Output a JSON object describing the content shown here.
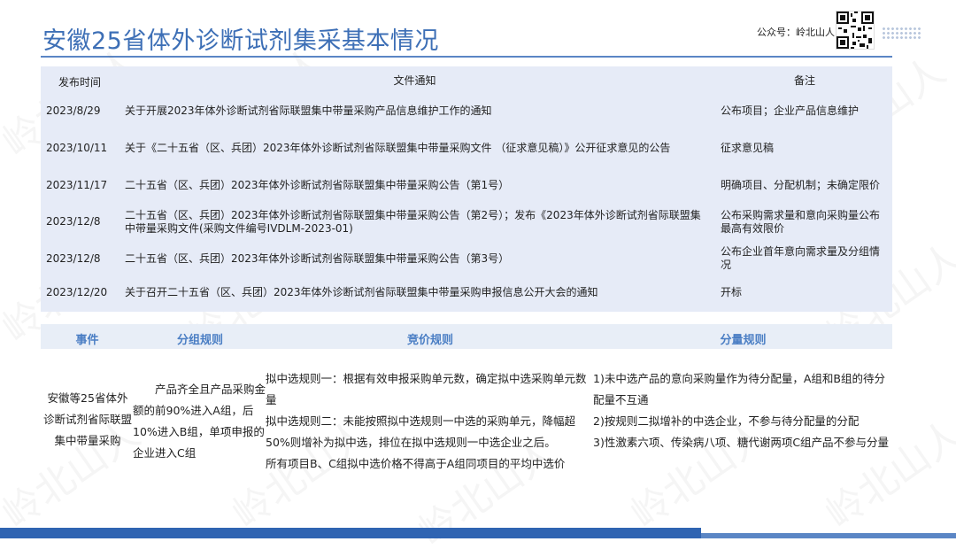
{
  "title": "安徽25省体外诊断试剂集采基本情况",
  "account_label": "公众号：岭北山人",
  "watermark": "岭北山人",
  "notice_table": {
    "headers": [
      "发布时间",
      "文件通知",
      "备注"
    ],
    "rows": [
      {
        "date": "2023/8/29",
        "notice": "关于开展2023年体外诊断试剂省际联盟集中带量采购产品信息维护工作的通知",
        "remark": "公布项目；企业产品信息维护"
      },
      {
        "date": "2023/10/11",
        "notice": "关于《二十五省（区、兵团）2023年体外诊断试剂省际联盟集中带量采购文件 （征求意见稿）》公开征求意见的公告",
        "remark": "征求意见稿"
      },
      {
        "date": "2023/11/17",
        "notice": "二十五省（区、兵团）2023年体外诊断试剂省际联盟集中带量采购公告（第1号）",
        "remark": "明确项目、分配机制；未确定限价"
      },
      {
        "date": "2023/12/8",
        "notice": "二十五省（区、兵团）2023年体外诊断试剂省际联盟集中带量采购公告（第2号）；发布《2023年体外诊断试剂省际联盟集中带量采购文件(采购文件编号IVDLM-2023-01)",
        "remark": "公布采购需求量和意向采购量公布最高有效限价"
      },
      {
        "date": "2023/12/8",
        "notice": "二十五省（区、兵团）2023年体外诊断试剂省际联盟集中带量采购公告（第3号）",
        "remark": "公布企业首年意向需求量及分组情况"
      },
      {
        "date": "2023/12/20",
        "notice": "关于召开二十五省（区、兵团）2023年体外诊断试剂省际联盟集中带量采购申报信息公开大会的通知",
        "remark": "开标"
      }
    ]
  },
  "rules_table": {
    "headers": [
      "事件",
      "分组规则",
      "竞价规则",
      "分量规则"
    ],
    "event": "安徽等25省体外诊断试剂省际联盟集中带量采购",
    "grouping": "产品齐全且产品采购金额的前90%进入A组，后10%进入B组，单项申报的企业进入C组",
    "bidding": [
      "拟中选规则一：根据有效申报采购单元数，确定拟中选采购单元数量",
      "拟中选规则二：未能按照拟中选规则一中选的采购单元，降幅超50%则增补为拟中选，排位在拟中选规则一中选企业之后。",
      "所有项目B、C组拟中选价格不得高于A组同项目的平均中选价"
    ],
    "allocation": [
      "1)未中选产品的意向采购量作为待分配量，A组和B组的待分配量不互通",
      "2)按规则二拟增补的中选企业，不参与待分配量的分配",
      "3)性激素六项、传染病八项、糖代谢两项C组产品不参与分量"
    ]
  }
}
